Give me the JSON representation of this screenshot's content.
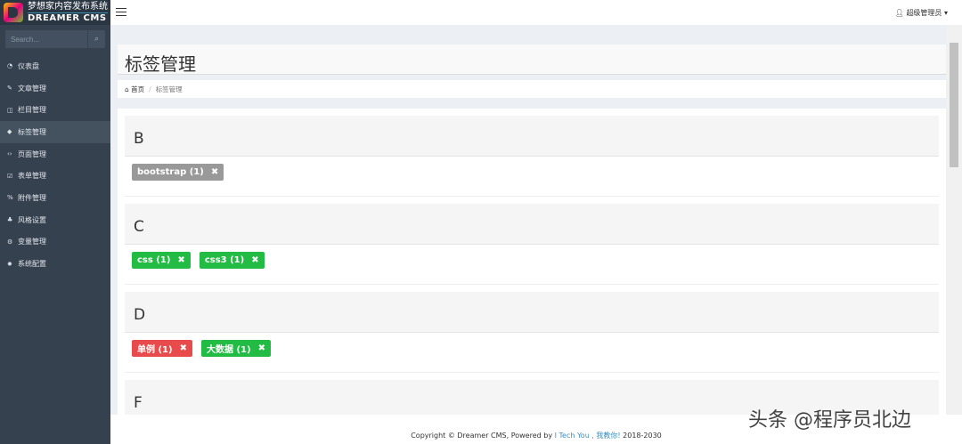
{
  "app": {
    "logo_cn": "梦想家内容发布系统",
    "logo_en": "DREAMER CMS"
  },
  "search": {
    "placeholder": "Search..."
  },
  "sidebar": {
    "items": [
      {
        "label": "仪表盘",
        "icon": "dashboard-icon",
        "glyph": "◔"
      },
      {
        "label": "文章管理",
        "icon": "edit-icon",
        "glyph": "✎"
      },
      {
        "label": "栏目管理",
        "icon": "columns-icon",
        "glyph": "◫"
      },
      {
        "label": "标签管理",
        "icon": "tags-icon",
        "glyph": "◆"
      },
      {
        "label": "页面管理",
        "icon": "code-icon",
        "glyph": "‹›"
      },
      {
        "label": "表单管理",
        "icon": "check-square-icon",
        "glyph": "☑"
      },
      {
        "label": "附件管理",
        "icon": "paperclip-icon",
        "glyph": "%"
      },
      {
        "label": "风格设置",
        "icon": "puzzle-icon",
        "glyph": "♣"
      },
      {
        "label": "变量管理",
        "icon": "cogs-icon",
        "glyph": "⚙"
      },
      {
        "label": "系统配置",
        "icon": "gear-icon",
        "glyph": "✹"
      }
    ]
  },
  "topbar": {
    "user": "超级管理员"
  },
  "page": {
    "title": "标签管理",
    "breadcrumb_home": "首页",
    "breadcrumb_current": "标签管理"
  },
  "groups": [
    {
      "letter": "B",
      "tags": [
        {
          "label": "bootstrap (1)",
          "color": "#999999"
        }
      ]
    },
    {
      "letter": "C",
      "tags": [
        {
          "label": "css (1)",
          "color": "#22bb44"
        },
        {
          "label": "css3 (1)",
          "color": "#22bb44"
        }
      ]
    },
    {
      "letter": "D",
      "tags": [
        {
          "label": "单例 (1)",
          "color": "#e84b4b"
        },
        {
          "label": "大数据 (1)",
          "color": "#22bb44"
        }
      ]
    },
    {
      "letter": "F",
      "tags": []
    }
  ],
  "footer": {
    "prefix": "Copyright © Dreamer CMS, Powered by ",
    "link": "I Tech You , 我教你!",
    "suffix": " 2018-2030"
  },
  "watermark": "头条 @程序员北边"
}
